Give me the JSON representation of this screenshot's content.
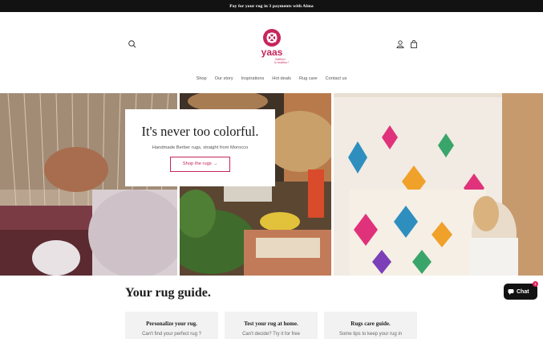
{
  "announcement": {
    "text": "Pay for your rug in 3 payments with Alma"
  },
  "brand": {
    "name": "yaas",
    "tagline_line1": "Sublimer",
    "tagline_line2": "la tradition !",
    "color": "#c7255c"
  },
  "nav": [
    {
      "label": "Shop"
    },
    {
      "label": "Our story"
    },
    {
      "label": "Inspirations"
    },
    {
      "label": "Hot deals"
    },
    {
      "label": "Rug care"
    },
    {
      "label": "Contact us"
    }
  ],
  "icons": {
    "search": "search-icon",
    "account": "user-icon",
    "cart": "bag-icon",
    "chat": "chat-bubble-icon"
  },
  "hero": {
    "title": "It's never too colorful.",
    "subtitle": "Handmade Berber rugs, straight from Morocco",
    "cta": "Shop the rugs →"
  },
  "guide": {
    "title": "Your rug guide.",
    "cards": [
      {
        "title": "Personalize your rug.",
        "text": "Can't find your perfect rug ?"
      },
      {
        "title": "Test your rug at home.",
        "text": "Can't decide? Try it for free"
      },
      {
        "title": "Rugs care guide.",
        "text": "Some tips to keep your rug in"
      }
    ]
  },
  "chat": {
    "label": "Chat",
    "badge": "1"
  }
}
